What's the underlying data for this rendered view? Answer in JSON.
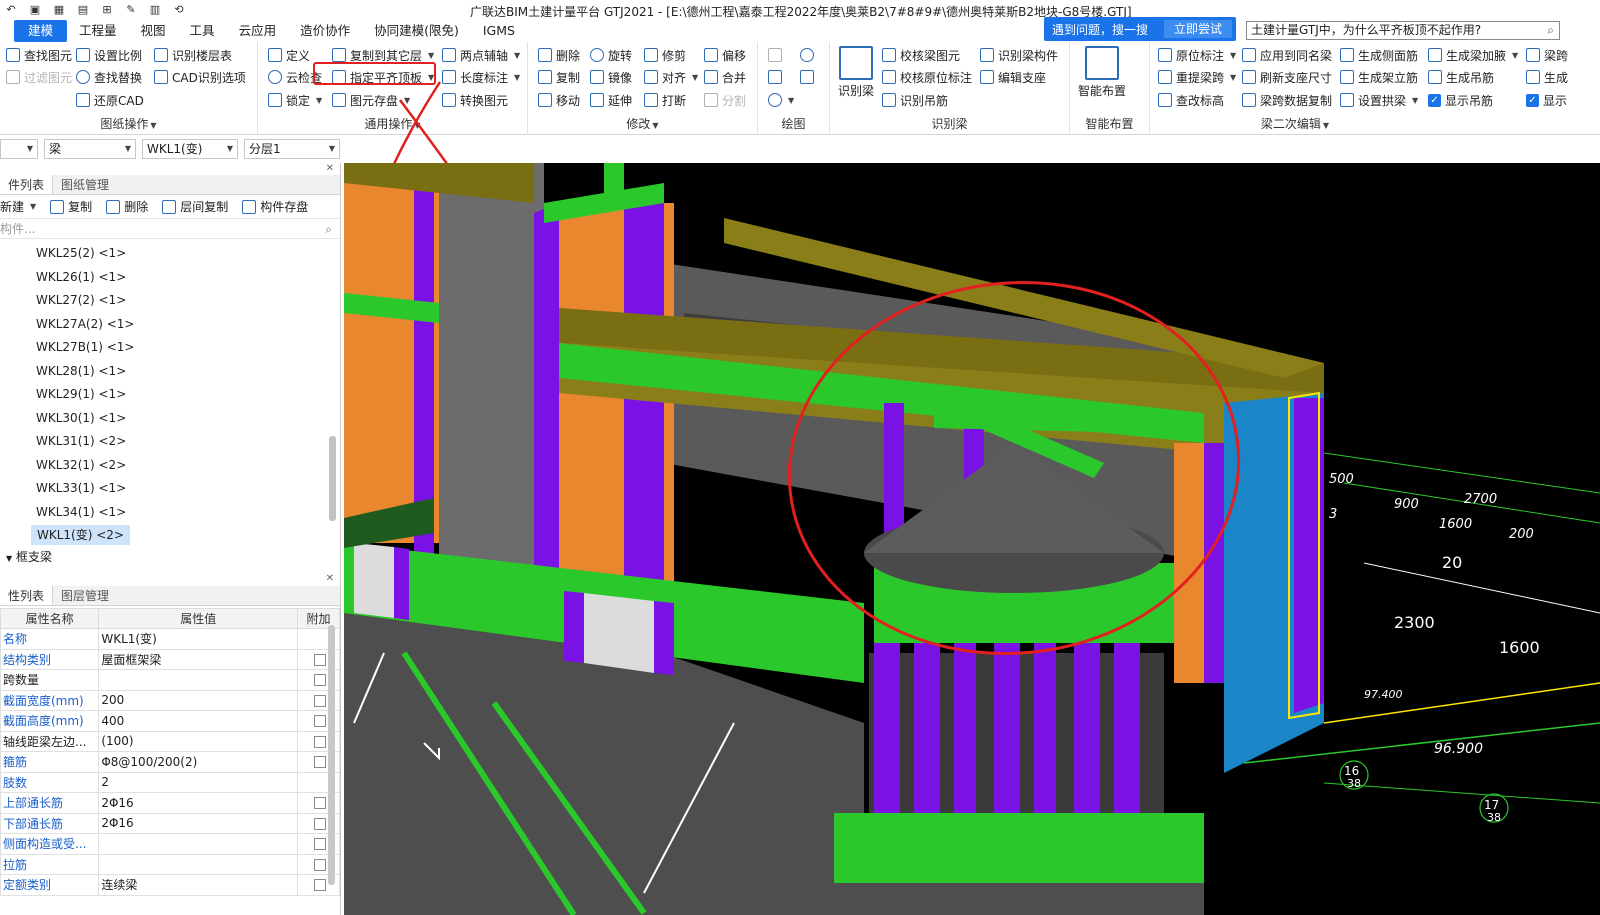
{
  "titlebar": {
    "title": "广联达BIM土建计量平台 GTJ2021 - [E:\\德州工程\\嘉泰工程2022年度\\奥莱B2\\7#8#9#\\德州奥特莱斯B2地块-G8号楼.GTJ]"
  },
  "menu": {
    "items": [
      "建模",
      "工程量",
      "视图",
      "工具",
      "云应用",
      "造价协作",
      "协同建模(限免)",
      "IGMS"
    ]
  },
  "help": {
    "question": "遇到问题，搜一搜",
    "try_label": "立即尝试",
    "search_value": "土建计量GTJ中，为什么平齐板顶不起作用?"
  },
  "ribbon": {
    "drawing_ops": {
      "label": "图纸操作",
      "buttons": [
        "查找图元",
        "过滤图元",
        "设置比例",
        "查找替换",
        "还原CAD",
        "识别楼层表",
        "CAD识别选项"
      ]
    },
    "general_ops": {
      "label": "通用操作",
      "buttons": [
        "定义",
        "云检查",
        "锁定",
        "复制到其它层",
        "指定平齐顶板",
        "图元存盘",
        "两点辅轴",
        "长度标注",
        "转换图元"
      ]
    },
    "modify": {
      "label": "修改",
      "buttons": [
        "删除",
        "复制",
        "移动",
        "旋转",
        "镜像",
        "延伸",
        "修剪",
        "对齐",
        "打断",
        "偏移",
        "合并",
        "分割"
      ]
    },
    "draw": {
      "label": "绘图"
    },
    "recognize_beam": {
      "label": "识别梁",
      "big_button": "识别梁",
      "buttons": [
        "校核梁图元",
        "校核原位标注",
        "识别吊筋",
        "识别梁构件",
        "编辑支座"
      ]
    },
    "smart_layout": {
      "label": "智能布置",
      "big_button": "智能布置"
    },
    "beam_edit": {
      "label": "梁二次编辑",
      "buttons": [
        "原位标注",
        "重提梁跨",
        "查改标高",
        "应用到同名梁",
        "刷新支座尺寸",
        "梁跨数据复制",
        "生成侧面筋",
        "生成架立筋",
        "设置拱梁",
        "生成梁加腋",
        "生成吊筋",
        "显示吊筋",
        "梁跨",
        "生成",
        "显示"
      ]
    }
  },
  "filters": {
    "floor": "",
    "type": "梁",
    "component": "WKL1(变)",
    "layer": "分层1"
  },
  "component_list": {
    "tab_active": "件列表",
    "tab_other": "图纸管理",
    "tools": [
      "新建",
      "复制",
      "删除",
      "层间复制",
      "构件存盘"
    ],
    "search_placeholder": "构件...",
    "items": [
      "WKL25(2)  <1>",
      "WKL26(1)  <1>",
      "WKL27(2)  <1>",
      "WKL27A(2)  <1>",
      "WKL27B(1)  <1>",
      "WKL28(1)  <1>",
      "WKL29(1)  <1>",
      "WKL30(1)  <1>",
      "WKL31(1)  <2>",
      "WKL32(1)  <2>",
      "WKL33(1)  <1>",
      "WKL34(1)  <1>",
      "WKL1(变)   <2>"
    ],
    "selected_index": 12,
    "group_next": "框支梁"
  },
  "properties": {
    "tab_active": "性列表",
    "tab_other": "图层管理",
    "headers": [
      "属性名称",
      "属性值",
      "附加"
    ],
    "rows": [
      {
        "name": "名称",
        "value": "WKL1(变)",
        "link": true,
        "check": false
      },
      {
        "name": "结构类别",
        "value": "屋面框架梁",
        "link": true,
        "check": true
      },
      {
        "name": "跨数量",
        "value": "",
        "link": false,
        "check": true
      },
      {
        "name": "截面宽度(mm)",
        "value": "200",
        "link": true,
        "check": true
      },
      {
        "name": "截面高度(mm)",
        "value": "400",
        "link": true,
        "check": true
      },
      {
        "name": "轴线距梁左边...",
        "value": "(100)",
        "link": false,
        "check": true
      },
      {
        "name": "箍筋",
        "value": "Φ8@100/200(2)",
        "link": true,
        "check": true
      },
      {
        "name": "肢数",
        "value": "2",
        "link": true,
        "check": false
      },
      {
        "name": "上部通长筋",
        "value": "2Φ16",
        "link": true,
        "check": true
      },
      {
        "name": "下部通长筋",
        "value": "2Φ16",
        "link": true,
        "check": true
      },
      {
        "name": "侧面构造或受...",
        "value": "",
        "link": true,
        "check": true
      },
      {
        "name": "拉筋",
        "value": "",
        "link": true,
        "check": true
      },
      {
        "name": "定额类别",
        "value": "连续梁",
        "link": true,
        "check": true
      }
    ]
  },
  "viewport": {
    "dims": [
      "500",
      "900",
      "2700",
      "1600",
      "200",
      "3",
      "20",
      "2300",
      "1600",
      "97.400",
      "96.900",
      "16",
      "38",
      "17",
      "38"
    ],
    "colors": {
      "bg": "#000000",
      "beam_green": "#2bc82b",
      "column_purple": "#7a12e6",
      "wall_orange": "#e8872e",
      "slab_gray": "#5a5a5a",
      "beam_olive": "#7a6e12",
      "wall_blue": "#1a86c8",
      "annotation_red": "#e32020"
    }
  }
}
